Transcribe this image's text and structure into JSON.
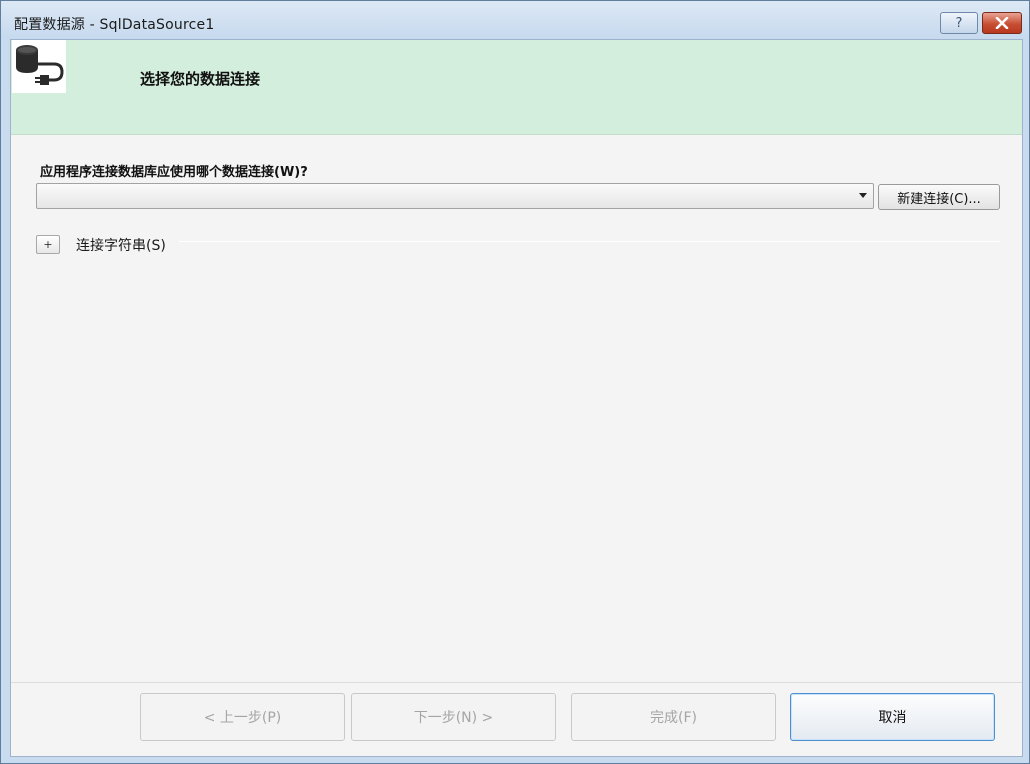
{
  "window": {
    "title": "配置数据源 - SqlDataSource1",
    "help_label": "?",
    "close_label": "✕"
  },
  "header": {
    "icon": "database-connection-icon",
    "title": "选择您的数据连接"
  },
  "connection": {
    "question": "应用程序连接数据库应使用哪个数据连接(W)?",
    "selected_value": "",
    "new_connection_label": "新建连接(C)..."
  },
  "connection_string": {
    "expand_label": "+",
    "label": "连接字符串(S)"
  },
  "footer": {
    "prev_label": "< 上一步(P)",
    "next_label": "下一步(N) >",
    "finish_label": "完成(F)",
    "cancel_label": "取消"
  },
  "colors": {
    "header_band": "#d4eedd",
    "client_bg": "#f4f4f4",
    "close_button": "#c84e33"
  }
}
